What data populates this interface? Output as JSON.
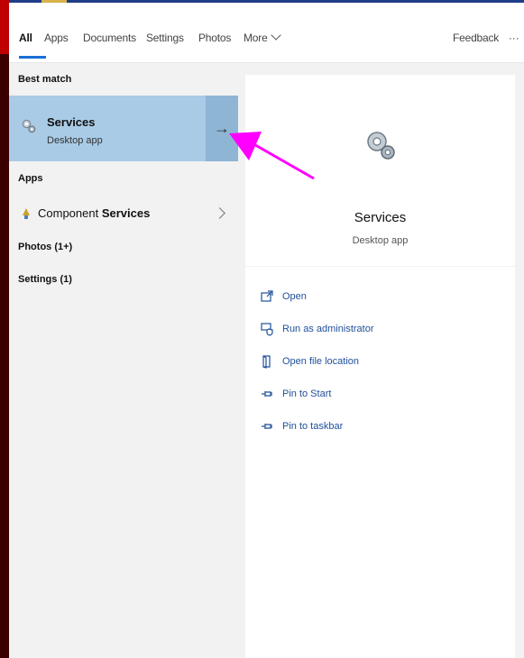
{
  "tabs": {
    "items": [
      {
        "label": "All",
        "active": true
      },
      {
        "label": "Apps"
      },
      {
        "label": "Documents"
      },
      {
        "label": "Settings"
      },
      {
        "label": "Photos"
      },
      {
        "label": "More"
      }
    ],
    "feedback": "Feedback",
    "overflow": "···"
  },
  "results": {
    "best_match_heading": "Best match",
    "best_match": {
      "title": "Services",
      "subtitle": "Desktop app",
      "arrow": "→",
      "icon": "gear-icon"
    },
    "apps_heading": "Apps",
    "app_item": {
      "prefix": "Component ",
      "highlight": "Services",
      "icon": "component-services-icon"
    },
    "photos_heading": "Photos (1+)",
    "settings_heading": "Settings (1)"
  },
  "preview": {
    "title": "Services",
    "subtitle": "Desktop app",
    "icon": "gear-icon",
    "actions": [
      {
        "label": "Open",
        "icon": "open-icon"
      },
      {
        "label": "Run as administrator",
        "icon": "shield-icon"
      },
      {
        "label": "Open file location",
        "icon": "file-location-icon"
      },
      {
        "label": "Pin to Start",
        "icon": "pin-icon"
      },
      {
        "label": "Pin to taskbar",
        "icon": "pin-icon"
      }
    ]
  },
  "colors": {
    "selection": "#a9cbe6",
    "selection_arrow": "#8fb5d5",
    "accent": "#1a6fd6",
    "link": "#1f4f9a",
    "annotation_arrow": "#ff00ff"
  }
}
